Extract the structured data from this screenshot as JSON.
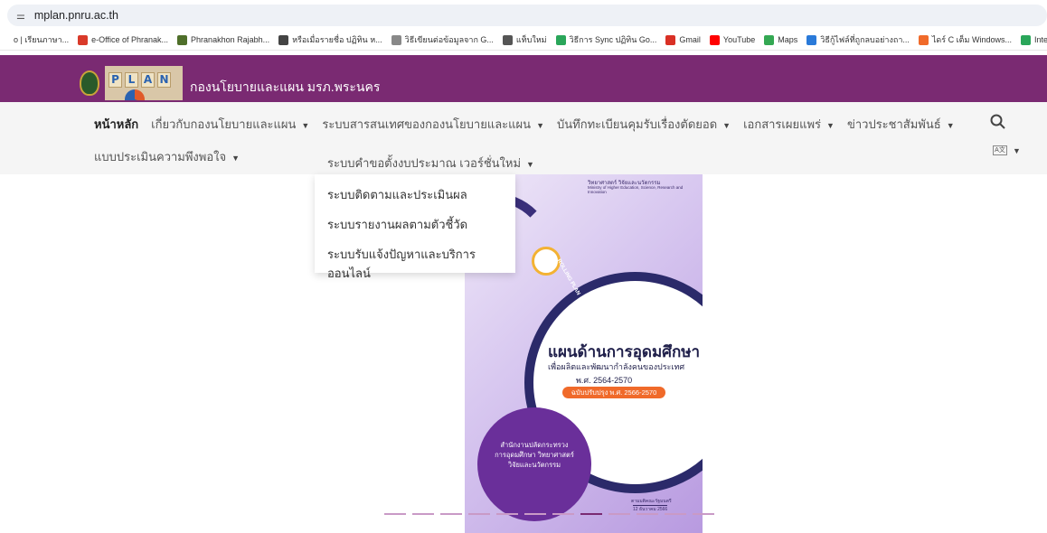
{
  "browser": {
    "url": "mplan.pnru.ac.th",
    "bookmarks": [
      {
        "label": "o | เรียนภาษา...",
        "icon": "blank-icon",
        "color": "#ffffff"
      },
      {
        "label": "e-Office of Phranak...",
        "icon": "toe-icon",
        "color": "#d93a2a"
      },
      {
        "label": "Phranakhon Rajabh...",
        "icon": "university-icon",
        "color": "#4f6f2a"
      },
      {
        "label": "หรือเมื่อรายชื่อ ปฏิทิน ห...",
        "icon": "apple-icon",
        "color": "#444444"
      },
      {
        "label": "วิธีเขียนต่อข้อมูลจาก G...",
        "icon": "clipboard-icon",
        "color": "#888888"
      },
      {
        "label": "แท็บใหม่",
        "icon": "globe-icon",
        "color": "#555555"
      },
      {
        "label": "วิธีการ Sync ปฏิทิน Go...",
        "icon": "sync-icon",
        "color": "#2aa65a"
      },
      {
        "label": "Gmail",
        "icon": "gmail-icon",
        "color": "#d93025"
      },
      {
        "label": "YouTube",
        "icon": "youtube-icon",
        "color": "#ff0000"
      },
      {
        "label": "Maps",
        "icon": "maps-icon",
        "color": "#34a853"
      },
      {
        "label": "วิธีกู้ไฟล์ที่ถูกลบอย่างถา...",
        "icon": "recover-icon",
        "color": "#2a7ad9"
      },
      {
        "label": "ไดร์ C เต็ม Windows...",
        "icon": "nb-icon",
        "color": "#f06a2a"
      },
      {
        "label": "Interne",
        "icon": "internet-icon",
        "color": "#2aa65a"
      }
    ]
  },
  "header": {
    "logo_letters": [
      "P",
      "L",
      "A",
      "N"
    ],
    "site_name": "กองนโยบายและแผน มรภ.พระนคร",
    "colors": {
      "header_bg": "#7a2a72"
    }
  },
  "nav": {
    "items": [
      {
        "label": "หน้าหลัก",
        "active": true,
        "has_caret": false
      },
      {
        "label": "เกี่ยวกับกองนโยบายและแผน",
        "active": false,
        "has_caret": true
      },
      {
        "label": "ระบบสารสนเทศของกองนโยบายและแผน",
        "active": false,
        "has_caret": true
      },
      {
        "label": "บันทึกทะเบียนคุมรับเรื่องตัดยอด",
        "active": false,
        "has_caret": true
      },
      {
        "label": "เอกสารเผยแพร่",
        "active": false,
        "has_caret": true
      },
      {
        "label": "ข่าวประชาสัมพันธ์",
        "active": false,
        "has_caret": true
      }
    ],
    "second_row_item": "แบบประเมินความพึงพอใจ",
    "lang_icon": "translate-icon",
    "search_icon": "search-icon",
    "caret": "▼"
  },
  "dropdown": {
    "trigger": "ระบบคำขอตั้งงบประมาณ เวอร์ชั่นใหม่",
    "items": [
      "ระบบติดตามและประเมินผล",
      "ระบบรายงานผลตามตัวชี้วัด",
      "ระบบรับแจ้งปัญหาและบริการออนไลน์"
    ]
  },
  "banner": {
    "ministry_line1": "วิทยาศาสตร์ วิจัยและนวัตกรรม",
    "ministry_line2": "Ministry of Higher Education, Science, Research and Innovation",
    "rolling": "ROLLING PLAN",
    "title": "แผนด้านการอุดมศึกษา",
    "subtitle1": "เพื่อผลิตและพัฒนากำลังคนของประเทศ",
    "subtitle2": "พ.ศ. 2564-2570",
    "edition": "ฉบับปรับปรุง พ.ศ. 2566-2570",
    "office": [
      "สำนักงานปลัดกระทรวง",
      "การอุดมศึกษา วิทยาศาสตร์",
      "วิจัยและนวัตกรรม"
    ],
    "date_line1": "ตามมติคณะรัฐมนตรี",
    "date_line2": "12 ธันวาคม 2566"
  },
  "carousel": {
    "count": 12,
    "active_index": 7
  }
}
